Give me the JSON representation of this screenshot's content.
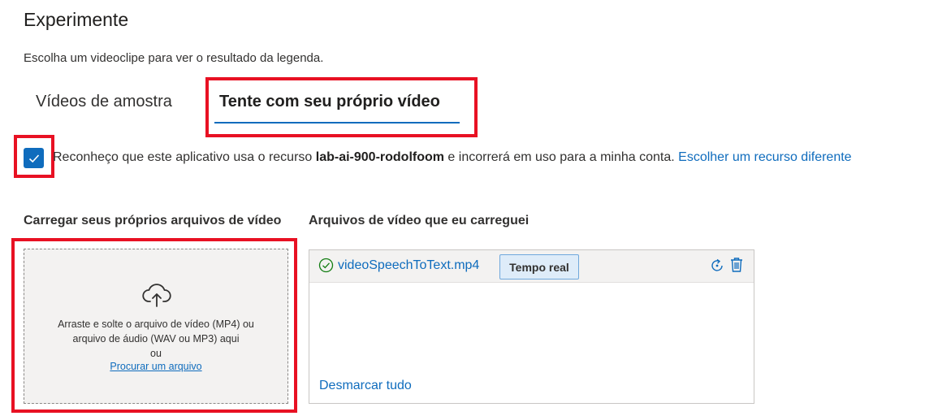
{
  "header": {
    "title": "Experimente",
    "subtitle": "Escolha um videoclipe para ver o resultado da legenda."
  },
  "tabs": [
    {
      "label": "Vídeos de amostra",
      "selected": false
    },
    {
      "label": "Tente com seu próprio vídeo",
      "selected": true
    }
  ],
  "consent": {
    "checked": true,
    "text_before": "Reconheço que este aplicativo usa o recurso ",
    "resource": "lab-ai-900-rodolfoom",
    "text_after": " e incorrerá em uso para a minha conta. ",
    "link": "Escolher um recurso diferente"
  },
  "upload": {
    "heading": "Carregar seus próprios arquivos de vídeo",
    "line1": "Arraste e solte o arquivo de vídeo (MP4) ou",
    "line2": "arquivo de áudio (WAV ou MP3) aqui",
    "line3": "ou",
    "browse_link": "Procurar um arquivo",
    "icon": "cloud-upload-icon"
  },
  "uploaded": {
    "heading": "Arquivos de vídeo que eu carreguei",
    "files": [
      {
        "name": "videoSpeechToText.mp4",
        "badge": "Tempo real",
        "status": "success"
      }
    ],
    "deselect_all": "Desmarcar tudo"
  },
  "colors": {
    "accent": "#0f6cbd",
    "highlight_red": "#e81123",
    "success_green": "#107c10"
  }
}
